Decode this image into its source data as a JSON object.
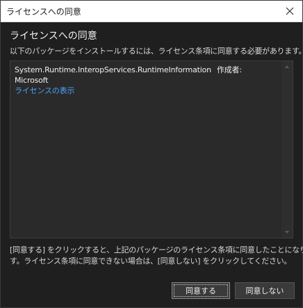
{
  "window": {
    "title": "ライセンスへの同意"
  },
  "dialog": {
    "heading": "ライセンスへの同意",
    "subheading": "以下のパッケージをインストールするには、ライセンス条項に同意する必要があります。"
  },
  "package": {
    "name": "System.Runtime.InteropServices.RuntimeInformation",
    "author_label": "作成者:",
    "author": "Microsoft",
    "license_link": "ライセンスの表示"
  },
  "notice": {
    "line1": "[同意する] をクリックすると、上記のパッケージのライセンス条項に同意したことになりま",
    "line2": "す。ライセンス条項に同意できない場合は、[同意しない] をクリックしてください。"
  },
  "buttons": {
    "agree": "同意する",
    "decline": "同意しない"
  },
  "icons": {
    "close": "close-icon",
    "scroll_up": "chevron-up-icon",
    "scroll_down": "chevron-down-icon"
  },
  "colors": {
    "background": "#1f1f1f",
    "titlebar": "#ffffff",
    "link": "#4aa3ff",
    "list_background": "#2a2a2a"
  }
}
